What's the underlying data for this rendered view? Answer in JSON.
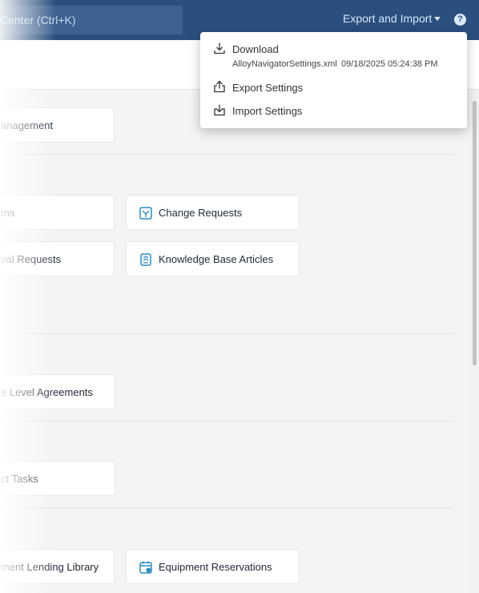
{
  "topbar": {
    "search_placeholder": "Center (Ctrl+K)",
    "export_import_label": "Export and Import",
    "help_label": "?"
  },
  "cards": {
    "management": "anagement",
    "items": "ms",
    "change_requests": "Change Requests",
    "approval_requests": "val Requests",
    "knowledge_base": "Knowledge Base Articles",
    "service_level": "e Level Agreements",
    "project_tasks": "ct Tasks",
    "lending_library": "ment Lending Library",
    "equipment_reservations": "Equipment Reservations"
  },
  "dropdown": {
    "download_label": "Download",
    "download_filename": "AlloyNavigatorSettings.xml",
    "download_timestamp": "09/18/2025 05:24:38 PM",
    "export_label": "Export Settings",
    "import_label": "Import Settings"
  },
  "colors": {
    "header": "#2a4f7e",
    "accent_icon": "#2b8bc6",
    "background": "#f4f4f4"
  }
}
